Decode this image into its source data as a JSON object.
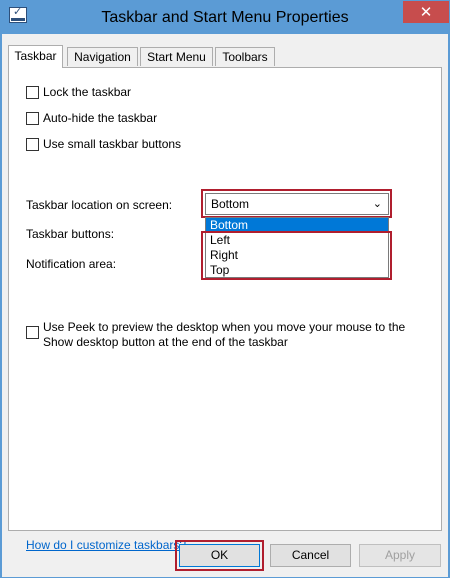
{
  "window": {
    "title": "Taskbar and Start Menu Properties",
    "close_glyph": "✕"
  },
  "tabs": [
    {
      "label": "Taskbar"
    },
    {
      "label": "Navigation"
    },
    {
      "label": "Start Menu"
    },
    {
      "label": "Toolbars"
    }
  ],
  "taskbar_tab": {
    "checkboxes": [
      {
        "label": "Lock the taskbar",
        "checked": false
      },
      {
        "label": "Auto-hide the taskbar",
        "checked": false
      },
      {
        "label": "Use small taskbar buttons",
        "checked": false
      }
    ],
    "location_label": "Taskbar location on screen:",
    "location_selected": "Bottom",
    "location_options": [
      "Bottom",
      "Left",
      "Right",
      "Top"
    ],
    "buttons_label": "Taskbar buttons:",
    "notification_label": "Notification area:",
    "peek_label": "Use Peek to preview the desktop when you move your mouse to the Show desktop button at the end of the taskbar",
    "peek_checked": false,
    "help_link": "How do I customize taskbars?"
  },
  "buttons": {
    "ok": "OK",
    "cancel": "Cancel",
    "apply": "Apply"
  },
  "colors": {
    "highlight": "#b01e2e",
    "titlebar": "#5b9bd5",
    "selection": "#0078d7"
  }
}
